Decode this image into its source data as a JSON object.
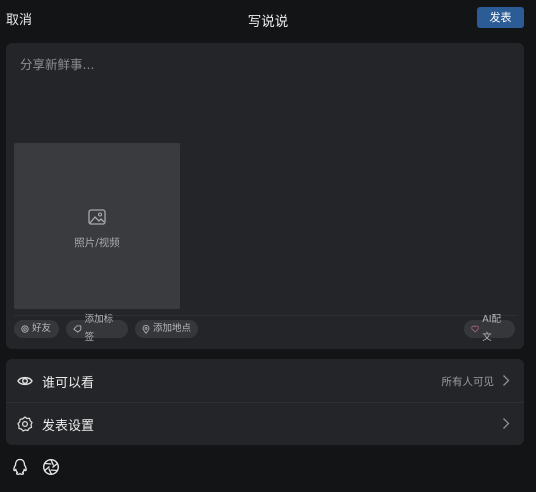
{
  "header": {
    "cancel_label": "取消",
    "title": "写说说",
    "publish_label": "发表"
  },
  "composer": {
    "placeholder": "分享新鲜事...",
    "media_label": "照片/视频",
    "media_icon": "image-icon",
    "chips": [
      {
        "label": "好友",
        "icon": "at-icon"
      },
      {
        "label": "添加标签",
        "icon": "tag-icon"
      },
      {
        "label": "添加地点",
        "icon": "location-pin-icon"
      },
      {
        "label": "AI配文",
        "icon": "heart-icon"
      }
    ]
  },
  "settings": {
    "visibility": {
      "label": "谁可以看",
      "value": "所有人可见",
      "icon": "eye-icon"
    },
    "publish_settings": {
      "label": "发表设置",
      "icon": "gear-icon"
    }
  },
  "bottom_bar": {
    "icons": [
      "qq-penguin-icon",
      "aperture-icon"
    ]
  },
  "colors": {
    "background": "#131416",
    "panel": "#242528",
    "accent": "#2b5c96"
  }
}
